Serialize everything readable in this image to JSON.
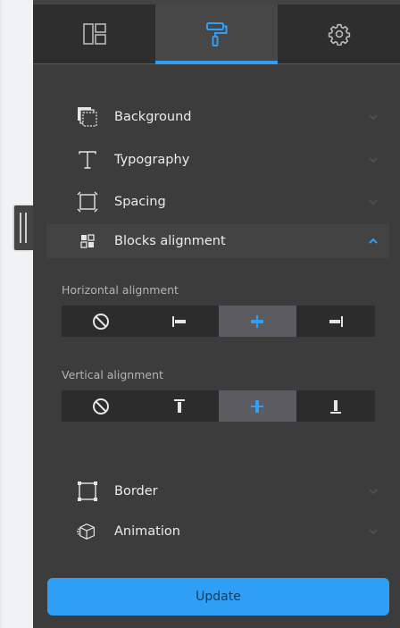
{
  "tabs": [
    {
      "icon": "layout-icon",
      "active": false
    },
    {
      "icon": "paint-roller-icon",
      "active": true
    },
    {
      "icon": "gear-icon",
      "active": false
    }
  ],
  "sections": {
    "background": {
      "label": "Background",
      "icon": "background-layers-icon"
    },
    "typography": {
      "label": "Typography",
      "icon": "text-t-icon"
    },
    "spacing": {
      "label": "Spacing",
      "icon": "spacing-square-icon"
    },
    "blocks_alignment": {
      "label": "Blocks alignment",
      "icon": "grid-blocks-icon",
      "expanded": true
    },
    "border": {
      "label": "Border",
      "icon": "border-square-icon"
    },
    "animation": {
      "label": "Animation",
      "icon": "animation-cube-icon"
    }
  },
  "horizontal_alignment": {
    "label": "Horizontal alignment",
    "options": [
      "none",
      "left",
      "center",
      "right"
    ],
    "selected": "center"
  },
  "vertical_alignment": {
    "label": "Vertical alignment",
    "options": [
      "none",
      "top",
      "middle",
      "bottom"
    ],
    "selected": "middle"
  },
  "update_label": "Update",
  "colors": {
    "accent": "#2f9ff5",
    "panel": "#3c3c3c",
    "tab_bar": "#2e2e2e",
    "selected_segment": "#5b5b60"
  }
}
